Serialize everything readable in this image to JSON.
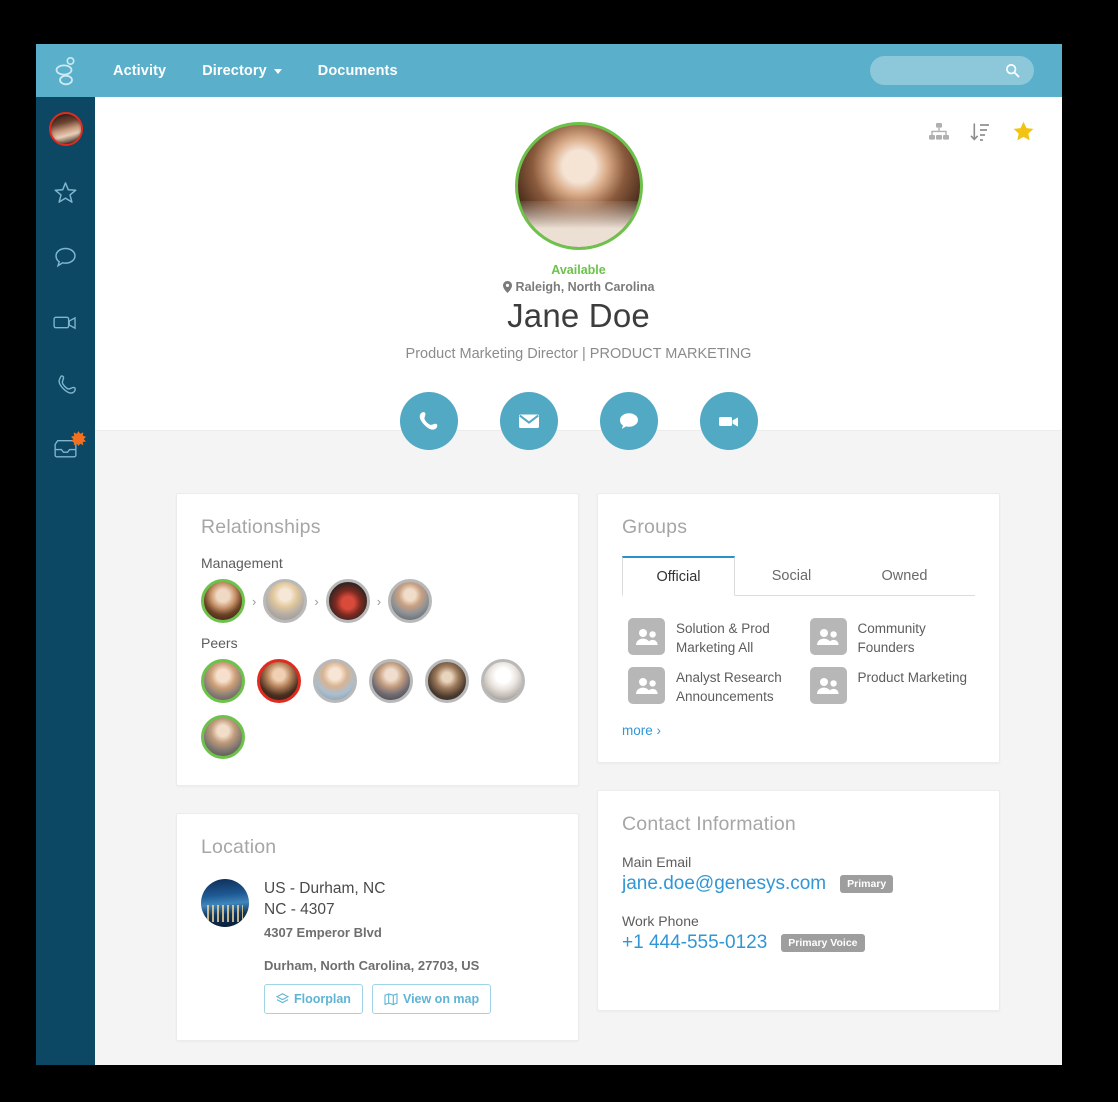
{
  "theme": {
    "nav_teal": "#5aafcb",
    "rail_navy": "#0c4763",
    "accent_blue": "#3196d6",
    "available_green": "#6cc24a",
    "busy_red": "#e02b20",
    "badge_orange": "#f4701f",
    "star_gold": "#f2c313",
    "page_bg": "#f4f4f4"
  },
  "topnav": {
    "logo_icon": "genesys-logo-icon",
    "links": [
      {
        "label": "Activity",
        "has_caret": false
      },
      {
        "label": "Directory",
        "has_caret": true
      },
      {
        "label": "Documents",
        "has_caret": false
      }
    ],
    "search": {
      "value": "",
      "placeholder": "",
      "icon": "search-icon"
    }
  },
  "rail": {
    "items": [
      {
        "name": "my-profile-avatar",
        "icon": "user-avatar",
        "ring": "#e02b20",
        "badge": false
      },
      {
        "name": "favorites",
        "icon": "star-outline-icon",
        "badge": false
      },
      {
        "name": "messages",
        "icon": "chat-bubble-icon",
        "badge": false
      },
      {
        "name": "video",
        "icon": "video-camera-icon",
        "badge": false
      },
      {
        "name": "calls",
        "icon": "phone-handset-icon",
        "badge": false
      },
      {
        "name": "inbox",
        "icon": "inbox-tray-icon",
        "badge": true
      }
    ]
  },
  "profile": {
    "avatar_icon": "profile-photo",
    "avatar_ring": "#6cc24a",
    "status": "Available",
    "location_icon": "map-pin-icon",
    "location": "Raleigh, North Carolina",
    "name": "Jane Doe",
    "title": "Product Marketing Director | PRODUCT MARKETING",
    "header_icons": [
      {
        "name": "org-chart-icon",
        "label": "Org chart"
      },
      {
        "name": "sort-descending-icon",
        "label": "Sort"
      },
      {
        "name": "favorite-star-icon",
        "label": "Favorite",
        "color": "#f2c313"
      }
    ],
    "actions": [
      {
        "name": "call-button",
        "icon": "phone-icon"
      },
      {
        "name": "email-button",
        "icon": "envelope-icon"
      },
      {
        "name": "chat-button",
        "icon": "chat-icon"
      },
      {
        "name": "video-button",
        "icon": "video-icon"
      }
    ]
  },
  "relationships": {
    "title": "Relationships",
    "management_label": "Management",
    "management": [
      {
        "status": "green"
      },
      {
        "status": "gray"
      },
      {
        "status": "gray"
      },
      {
        "status": "gray"
      }
    ],
    "peers_label": "Peers",
    "peers": [
      {
        "status": "green"
      },
      {
        "status": "red"
      },
      {
        "status": "gray"
      },
      {
        "status": "gray"
      },
      {
        "status": "gray"
      },
      {
        "status": "gray"
      },
      {
        "status": "green"
      }
    ]
  },
  "groups": {
    "title": "Groups",
    "tabs": [
      {
        "label": "Official",
        "active": true
      },
      {
        "label": "Social",
        "active": false
      },
      {
        "label": "Owned",
        "active": false
      }
    ],
    "items": [
      {
        "name": "Solution & Prod Marketing All",
        "icon": "people-group-icon"
      },
      {
        "name": "Community Founders",
        "icon": "people-group-icon"
      },
      {
        "name": "Analyst Research Announcements",
        "icon": "people-group-icon"
      },
      {
        "name": "Product Marketing",
        "icon": "people-group-icon"
      }
    ],
    "more_label": "more ›"
  },
  "location": {
    "title": "Location",
    "thumb_icon": "city-photo",
    "site": "US - Durham, NC",
    "building": "NC - 4307",
    "street": "4307 Emperor Blvd",
    "full_address": "Durham, North Carolina, 27703, US",
    "buttons": [
      {
        "label": "Floorplan",
        "icon": "layers-icon"
      },
      {
        "label": "View on map",
        "icon": "map-icon"
      }
    ]
  },
  "contact": {
    "title": "Contact Information",
    "entries": [
      {
        "label": "Main Email",
        "value": "jane.doe@genesys.com",
        "badge": "Primary"
      },
      {
        "label": "Work Phone",
        "value": "+1 444-555-0123",
        "badge": "Primary Voice"
      }
    ]
  }
}
